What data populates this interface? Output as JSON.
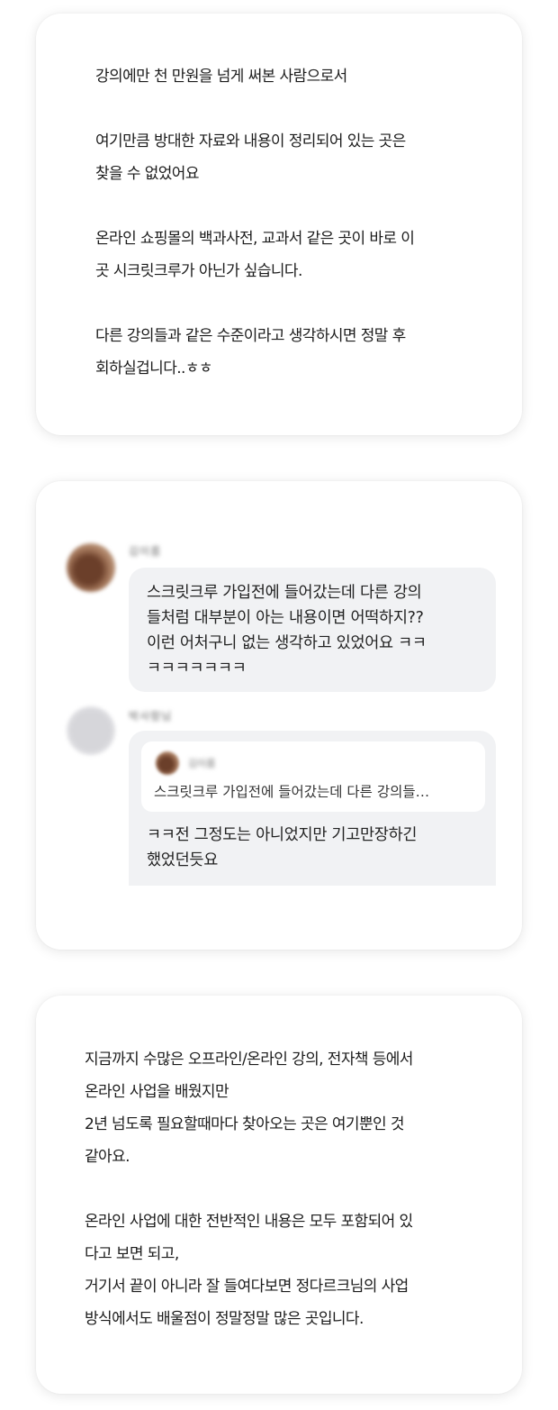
{
  "review1": {
    "paragraphs": [
      "강의에만 천 만원을 넘게 써본 사람으로서",
      "여기만큼 방대한 자료와 내용이 정리되어 있는 곳은\n찾을 수 없었어요",
      "온라인 쇼핑몰의 백과사전, 교과서 같은 곳이 바로 이\n곳 시크릿크루가 아닌가 싶습니다.",
      "다른 강의들과 같은 수준이라고 생각하시면 정말 후\n회하실겁니다..ㅎㅎ"
    ]
  },
  "comments": {
    "comment1": {
      "username": "김이름",
      "text": "스크릿크루 가입전에 들어갔는데 다른 강의\n들처럼 대부분이 아는 내용이면 어떡하지??\n이런 어처구니 없는 생각하고 있었어요 ㅋㅋ\nㅋㅋㅋㅋㅋㅋㅋ"
    },
    "comment2": {
      "username": "박사람님",
      "quote_username": "김이름",
      "quote_text": "스크릿크루 가입전에 들어갔는데 다른 강의들…",
      "text": "ㅋㅋ전 그정도는 아니었지만 기고만장하긴\n했었던듯요"
    }
  },
  "review2": {
    "paragraphs": [
      "지금까지 수많은 오프라인/온라인 강의, 전자책 등에서\n온라인 사업을 배웠지만\n2년 넘도록 필요할때마다 찾아오는 곳은 여기뿐인 것\n같아요.",
      "온라인 사업에 대한 전반적인 내용은 모두 포함되어 있\n다고 보면 되고,\n거기서 끝이 아니라 잘 들여다보면 정다르크님의 사업\n방식에서도 배울점이 정말정말 많은 곳입니다."
    ]
  }
}
